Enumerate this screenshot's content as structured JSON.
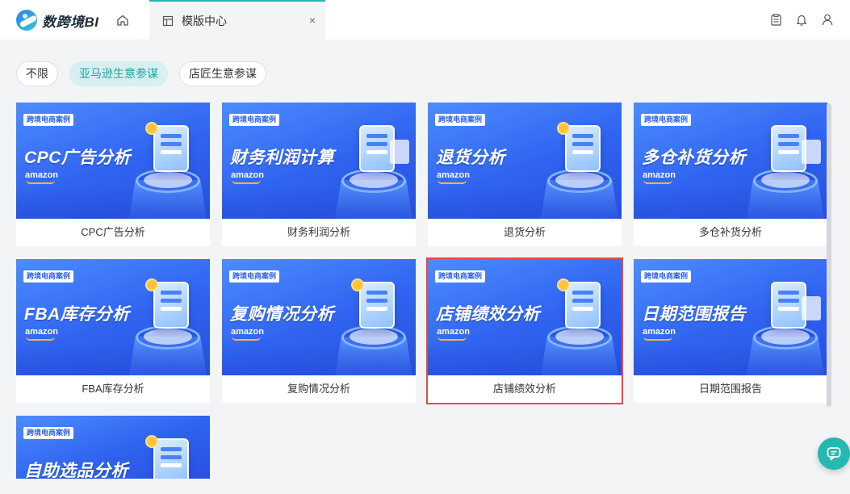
{
  "app": {
    "logo_text": "数跨境BI",
    "home_icon": "home-icon"
  },
  "tab": {
    "icon": "template-icon",
    "label": "模版中心",
    "close": "×"
  },
  "top_icons": [
    "clipboard-icon",
    "bell-icon",
    "user-icon"
  ],
  "filters": [
    {
      "label": "不限",
      "active": false
    },
    {
      "label": "亚马逊生意参谋",
      "active": true
    },
    {
      "label": "店匠生意参谋",
      "active": false
    }
  ],
  "cards": [
    {
      "tag": "跨境电商案例",
      "banner_title": "CPC广告分析",
      "brand": "amazon",
      "title": "CPC广告分析",
      "selected": false
    },
    {
      "tag": "跨境电商案例",
      "banner_title": "财务利润计算",
      "brand": "amazon",
      "title": "财务利润分析",
      "selected": false
    },
    {
      "tag": "跨境电商案例",
      "banner_title": "退货分析",
      "brand": "amazon",
      "title": "退货分析",
      "selected": false
    },
    {
      "tag": "跨境电商案例",
      "banner_title": "多仓补货分析",
      "brand": "amazon",
      "title": "多仓补货分析",
      "selected": false
    },
    {
      "tag": "跨境电商案例",
      "banner_title": "FBA库存分析",
      "brand": "amazon",
      "title": "FBA库存分析",
      "selected": false
    },
    {
      "tag": "跨境电商案例",
      "banner_title": "复购情况分析",
      "brand": "amazon",
      "title": "复购情况分析",
      "selected": false
    },
    {
      "tag": "跨境电商案例",
      "banner_title": "店铺绩效分析",
      "brand": "amazon",
      "title": "店铺绩效分析",
      "selected": true
    },
    {
      "tag": "跨境电商案例",
      "banner_title": "日期范围报告",
      "brand": "amazon",
      "title": "日期范围报告",
      "selected": false
    },
    {
      "tag": "跨境电商案例",
      "banner_title": "自助选品分析",
      "brand": "",
      "title": "",
      "selected": false,
      "partial": true
    }
  ],
  "chat": {
    "icon": "chat-icon"
  }
}
